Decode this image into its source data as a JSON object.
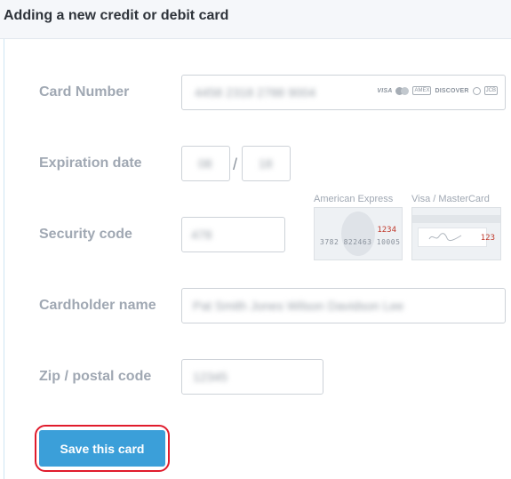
{
  "header": {
    "title": "Adding a new credit or debit card"
  },
  "form": {
    "card_number": {
      "label": "Card Number",
      "value": "4458 2318 2788 9004",
      "logos": [
        "VISA",
        "MC",
        "AMEX",
        "DISCOVER",
        "DINERS",
        "JCB"
      ]
    },
    "expiration": {
      "label": "Expiration date",
      "month": "08",
      "separator": "/",
      "year": "18"
    },
    "security": {
      "label": "Security code",
      "value": "478",
      "amex_caption": "American Express",
      "amex_code": "1234",
      "amex_number": "3782 822463 10005",
      "visa_caption": "Visa / MasterCard",
      "visa_code": "123"
    },
    "cardholder": {
      "label": "Cardholder name",
      "value": "Pat Smith Jones Wilson Davidson Lee"
    },
    "zip": {
      "label": "Zip / postal code",
      "value": "12345"
    }
  },
  "actions": {
    "save_label": "Save this card"
  },
  "colors": {
    "accent": "#3b9fd9",
    "highlight": "#e01b2c",
    "label": "#a0a8b3"
  }
}
